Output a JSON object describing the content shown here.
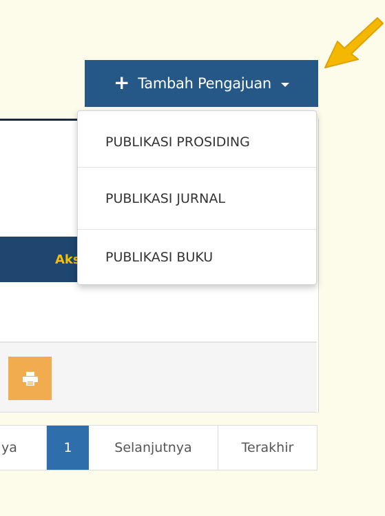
{
  "toolbar": {
    "add_button_label": "Tambah Pengajuan"
  },
  "dropdown": {
    "items": [
      {
        "label": "PUBLIKASI PROSIDING"
      },
      {
        "label": "PUBLIKASI JURNAL"
      },
      {
        "label": "PUBLIKASI BUKU"
      }
    ]
  },
  "table": {
    "header_partial_label": "Aks"
  },
  "pagination": {
    "prev_partial": "ya",
    "current": "1",
    "next": "Selanjutnya",
    "last": "Terakhir"
  },
  "colors": {
    "page_background": "#fdfbe9",
    "primary_button": "#255887",
    "table_header": "#1e466f",
    "header_text_accent": "#f2c200",
    "print_button": "#f0ac4e",
    "active_page": "#2e6eaa",
    "annotation_arrow": "#f5b800"
  },
  "icons": {
    "add": "plus-icon",
    "caret": "caret-down-icon",
    "print": "print-icon",
    "annotation": "arrow-pointer-icon"
  }
}
